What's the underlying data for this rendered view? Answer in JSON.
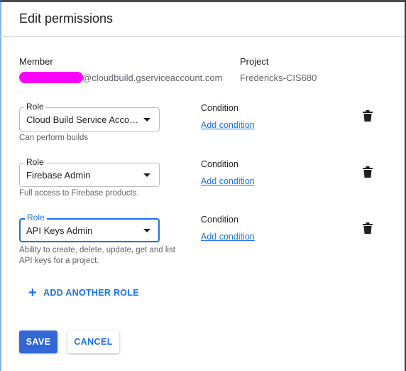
{
  "dialog": {
    "title": "Edit permissions"
  },
  "member": {
    "label": "Member",
    "email_suffix": "@cloudbuild.gserviceaccount.com"
  },
  "project": {
    "label": "Project",
    "value": "Fredericks-CIS680"
  },
  "roles": [
    {
      "legend": "Role",
      "value": "Cloud Build Service Account",
      "description": "Can perform builds",
      "condition_label": "Condition",
      "add_condition": "Add condition"
    },
    {
      "legend": "Role",
      "value": "Firebase Admin",
      "description": "Full access to Firebase products.",
      "condition_label": "Condition",
      "add_condition": "Add condition"
    },
    {
      "legend": "Role",
      "value": "API Keys Admin",
      "description_line1": "Ability to create, delete, update, get and list",
      "description_line2": "API keys for a project.",
      "condition_label": "Condition",
      "add_condition": "Add condition"
    }
  ],
  "add_another_role": "ADD ANOTHER ROLE",
  "actions": {
    "save": "SAVE",
    "cancel": "CANCEL"
  },
  "colors": {
    "accent": "#1a73e8",
    "save_bg": "#3367d6",
    "redaction": "#ff00ff"
  }
}
